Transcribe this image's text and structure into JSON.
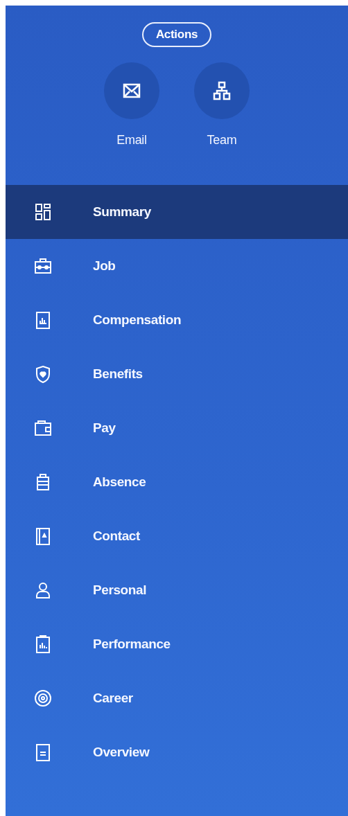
{
  "actions_button": "Actions",
  "quick_actions": [
    {
      "label": "Email"
    },
    {
      "label": "Team"
    }
  ],
  "nav_items": [
    {
      "label": "Summary",
      "selected": true
    },
    {
      "label": "Job",
      "selected": false
    },
    {
      "label": "Compensation",
      "selected": false
    },
    {
      "label": "Benefits",
      "selected": false
    },
    {
      "label": "Pay",
      "selected": false
    },
    {
      "label": "Absence",
      "selected": false
    },
    {
      "label": "Contact",
      "selected": false
    },
    {
      "label": "Personal",
      "selected": false
    },
    {
      "label": "Performance",
      "selected": false
    },
    {
      "label": "Career",
      "selected": false
    },
    {
      "label": "Overview",
      "selected": false
    }
  ]
}
